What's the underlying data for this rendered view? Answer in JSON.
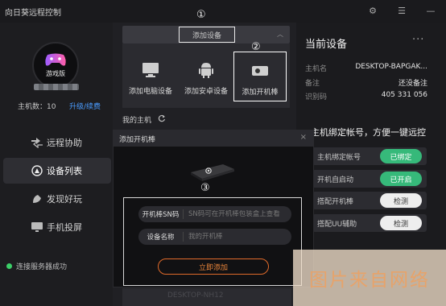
{
  "app": {
    "title": "向日葵远程控制"
  },
  "window_controls": {
    "settings_glyph": "⚙",
    "menu_glyph": "☰",
    "minimize_glyph": "—"
  },
  "sidebar": {
    "avatar_label": "游戏版",
    "host_count": "主机数：10",
    "upgrade": "升级/续费",
    "items": [
      {
        "label": "远程协助",
        "icon": "remote-assist-icon",
        "active": false
      },
      {
        "label": "设备列表",
        "icon": "device-list-icon",
        "active": true
      },
      {
        "label": "发现好玩",
        "icon": "discover-icon",
        "active": false
      },
      {
        "label": "手机投屏",
        "icon": "phone-cast-icon",
        "active": false
      }
    ],
    "status": "连接服务器成功"
  },
  "center": {
    "add_device_label": "添加设备",
    "add_options": [
      {
        "label": "添加电脑设备",
        "icon": "monitor-icon"
      },
      {
        "label": "添加安卓设备",
        "icon": "android-icon"
      },
      {
        "label": "添加开机棒",
        "icon": "boot-stick-icon"
      }
    ],
    "my_host_label": "我的主机",
    "below_text": "DESKTOP-NH12"
  },
  "dialog": {
    "title": "添加开机棒",
    "close_glyph": "×",
    "fields": [
      {
        "label": "开机棒SN码",
        "placeholder": "SN码可在开机棒包装盒上查看"
      },
      {
        "label": "设备名称",
        "placeholder": "我的开机棒"
      }
    ],
    "submit_label": "立即添加"
  },
  "right": {
    "title": "当前设备",
    "more_glyph": "···",
    "info": [
      {
        "key": "主机名",
        "value": "DESKTOP-BAPGAK..."
      },
      {
        "key": "备注",
        "value": "还没备注"
      },
      {
        "key": "识别码",
        "value": "405 331 056"
      }
    ],
    "bind_heading": "主机绑定帐号，方便一键远控",
    "options": [
      {
        "label": "主机绑定帐号",
        "button": "已绑定",
        "style": "green"
      },
      {
        "label": "开机自启动",
        "button": "已开启",
        "style": "green"
      },
      {
        "label": "搭配开机棒",
        "button": "检测",
        "style": "light"
      },
      {
        "label": "搭配UU辅助",
        "button": "检测",
        "style": "light"
      }
    ]
  },
  "annotations": [
    "①",
    "②",
    "③"
  ],
  "watermark": "图片来自网络",
  "colors": {
    "accent_green": "#36b97a",
    "accent_orange": "#e06a2a",
    "link_blue": "#4a9cff",
    "status_green": "#3ccf68"
  }
}
